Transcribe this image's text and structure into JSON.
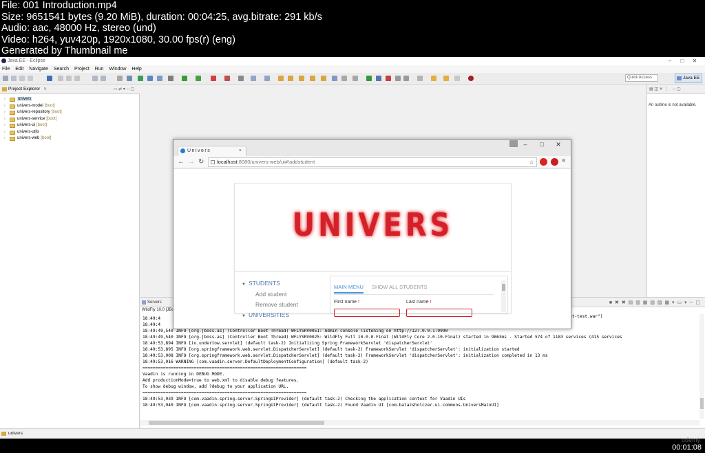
{
  "thumbnail_info": {
    "file": "File: 001 Introduction.mp4",
    "size": "Size: 9651541 bytes (9.20 MiB), duration: 00:04:25, avg.bitrate: 291 kb/s",
    "audio": "Audio: aac, 48000 Hz, stereo (und)",
    "video": "Video: h264, yuv420p, 1920x1080, 30.00 fps(r) (eng)",
    "generator": "Generated by Thumbnail me"
  },
  "eclipse": {
    "window_title": "Java EE - Eclipse",
    "window_controls": [
      "–",
      "□",
      "✕"
    ],
    "menu": [
      "File",
      "Edit",
      "Navigate",
      "Search",
      "Project",
      "Run",
      "Window",
      "Help"
    ],
    "quick_access_placeholder": "Quick Access",
    "perspective": "Java EE",
    "project_explorer": {
      "tab_title": "Project Explorer",
      "items": [
        {
          "name": "univers",
          "tag": ""
        },
        {
          "name": "univers-model",
          "tag": "[boot]"
        },
        {
          "name": "univers-repository",
          "tag": "[boot]"
        },
        {
          "name": "univers-service",
          "tag": "[boot]"
        },
        {
          "name": "univers-ui",
          "tag": "[boot]"
        },
        {
          "name": "univers-utils",
          "tag": ""
        },
        {
          "name": "univers-web",
          "tag": "[boot]"
        }
      ]
    },
    "outline": {
      "message": "An outline is not available."
    },
    "console": {
      "tab_title": "Servers",
      "title": "WildFly 10.0 [JBoss",
      "lines": [
        "18:49:4",
        "18:49:4",
        "18:49:49,540 INFO  [org.jboss.as] (Controller Boot Thread) WFLYSRV0051: Admin console listening on http://127.0.0.1:9990",
        "18:49:49,540 INFO  [org.jboss.as] (Controller Boot Thread) WFLYSRV0025: WildFly Full 10.0.0.Final (WildFly Core 2.0.10.Final) started in 9863ms - Started 574 of 1183 services (415 services",
        "18:49:53,894 INFO  [io.undertow.servlet] (default task-2) Initializing Spring FrameworkServlet 'dispatcherServlet'",
        "18:49:53,895 INFO  [org.springframework.web.servlet.DispatcherServlet] (default task-2) FrameworkServlet 'dispatcherServlet': initialization started",
        "18:49:53,908 INFO  [org.springframework.web.servlet.DispatcherServlet] (default task-2) FrameworkServlet 'dispatcherServlet': initialization completed in 13 ms",
        "18:49:53,916 WARNING [com.vaadin.server.DefaultDeploymentConfiguration] (default task-2)",
        "================================================================",
        "Vaadin is running in DEBUG MODE.",
        "Add productionMode=true to web.xml to disable debug features.",
        "To show debug window, add ?debug to your application URL.",
        "================================================================",
        "18:49:53,939 INFO  [com.vaadin.spring.server.SpringUIProvider] (default task-2) Checking the application context for Vaadin UIs",
        "18:49:53,940 INFO  [com.vaadin.spring.server.SpringUIProvider] (default task-2) Found Vaadin UI [com.balazsholczer.ui.commons.UniversMainUI]"
      ],
      "right_fragment_1": "ot-test.war\")"
    },
    "status": "univers"
  },
  "browser": {
    "tab_title": "Univers",
    "tab_close": "×",
    "window_controls": [
      "–",
      "□",
      "✕"
    ],
    "url_host": "localhost",
    "url_path": ":8080/univers-web/ui#!addstudent",
    "page": {
      "logo": "UNIVERS",
      "nav": {
        "group_students": "STUDENTS",
        "add_student": "Add student",
        "remove_student": "Remove student",
        "group_universities": "UNIVERSITIES"
      },
      "tabs": [
        "MAIN MENU",
        "SHOW ALL STUDENTS"
      ],
      "first_name_label": "First name",
      "last_name_label": "Last name",
      "required_mark": "!"
    }
  },
  "video": {
    "timestamp": "00:01:08",
    "watermark": "udemy"
  },
  "colors": {
    "logo_red": "#d42028",
    "link_blue": "#4a90d9",
    "eclipse_bg": "#f0f0f0"
  }
}
